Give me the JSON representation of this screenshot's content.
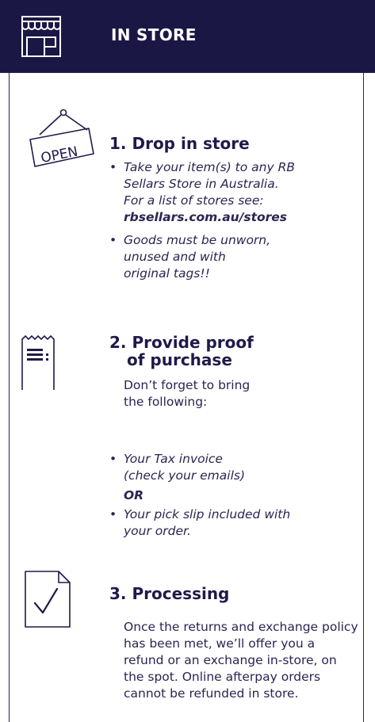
{
  "header": {
    "title": "IN STORE",
    "icon": "storefront-icon"
  },
  "step1": {
    "title": "1. Drop in store",
    "icon": "open-sign-icon",
    "sign_text": "OPEN",
    "bullet1": {
      "text": "Take your item(s) to any RB Sellars Store in Australia. For a list of stores see:",
      "link": "rbsellars.com.au/stores"
    },
    "bullet2": "Goods must be unworn, unused and with original tags!!"
  },
  "step2": {
    "title_line1": "2. Provide proof",
    "title_line2": "of purchase",
    "icon": "receipt-icon",
    "intro": "Don’t forget to bring the following:",
    "bullet1": "Your Tax invoice (check your emails)",
    "or": "OR",
    "bullet2": "Your pick slip included with your order."
  },
  "step3": {
    "title": "3. Processing",
    "icon": "document-check-icon",
    "text": "Once the returns and exchange policy has been met, we’ll offer you a refund or an exchange in-store, on the spot. Online afterpay orders cannot be refunded in store."
  }
}
